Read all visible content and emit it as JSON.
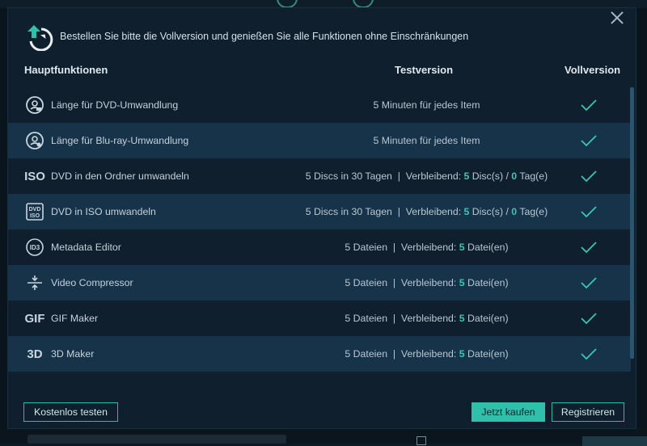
{
  "header": {
    "message": "Bestellen Sie bitte die Vollversion und genießen Sie alle Funktionen ohne Einschränkungen"
  },
  "columns": {
    "main": "Hauptfunktionen",
    "trial": "Testversion",
    "full": "Vollversion"
  },
  "features": [
    {
      "icon": "dvd-disc-icon",
      "name": "Länge für DVD-Umwandlung",
      "trial": {
        "pre": "5 Minuten für jedes Item"
      }
    },
    {
      "icon": "bluray-disc-icon",
      "name": "Länge für Blu-ray-Umwandlung",
      "trial": {
        "pre": "5 Minuten für jedes Item"
      }
    },
    {
      "icon": "iso-icon",
      "icon_text": "ISO",
      "name": "DVD in den Ordner umwandeln",
      "trial": {
        "pre": "5 Discs in 30 Tagen  |  Verbleibend: ",
        "n1": "5",
        "mid": " Disc(s) / ",
        "n2": "0",
        "post": " Tag(e)"
      }
    },
    {
      "icon": "dvd-iso-icon",
      "name": "DVD in ISO umwandeln",
      "trial": {
        "pre": "5 Discs in 30 Tagen  |  Verbleibend: ",
        "n1": "5",
        "mid": " Disc(s) / ",
        "n2": "0",
        "post": " Tag(e)"
      }
    },
    {
      "icon": "id3-icon",
      "icon_text": "ID3",
      "name": "Metadata Editor",
      "trial": {
        "pre": "5 Dateien  |  Verbleibend: ",
        "n1": "5",
        "mid": " Datei(en)"
      }
    },
    {
      "icon": "compress-icon",
      "name": "Video Compressor",
      "trial": {
        "pre": "5 Dateien  |  Verbleibend: ",
        "n1": "5",
        "mid": " Datei(en)"
      }
    },
    {
      "icon": "gif-icon",
      "icon_text": "GIF",
      "name": "GIF Maker",
      "trial": {
        "pre": "5 Dateien  |  Verbleibend: ",
        "n1": "5",
        "mid": " Datei(en)"
      }
    },
    {
      "icon": "3d-icon",
      "icon_text": "3D",
      "name": "3D Maker",
      "trial": {
        "pre": "5 Dateien  |  Verbleibend: ",
        "n1": "5",
        "mid": " Datei(en)"
      }
    }
  ],
  "buttons": {
    "trial": "Kostenlos testen",
    "buy": "Jetzt kaufen",
    "register": "Registrieren"
  },
  "colors": {
    "accent": "#2fbfaa",
    "highlight_number": "#37c8b3",
    "row_alt": "#163349",
    "dialog_bg": "#0f1f2d"
  }
}
